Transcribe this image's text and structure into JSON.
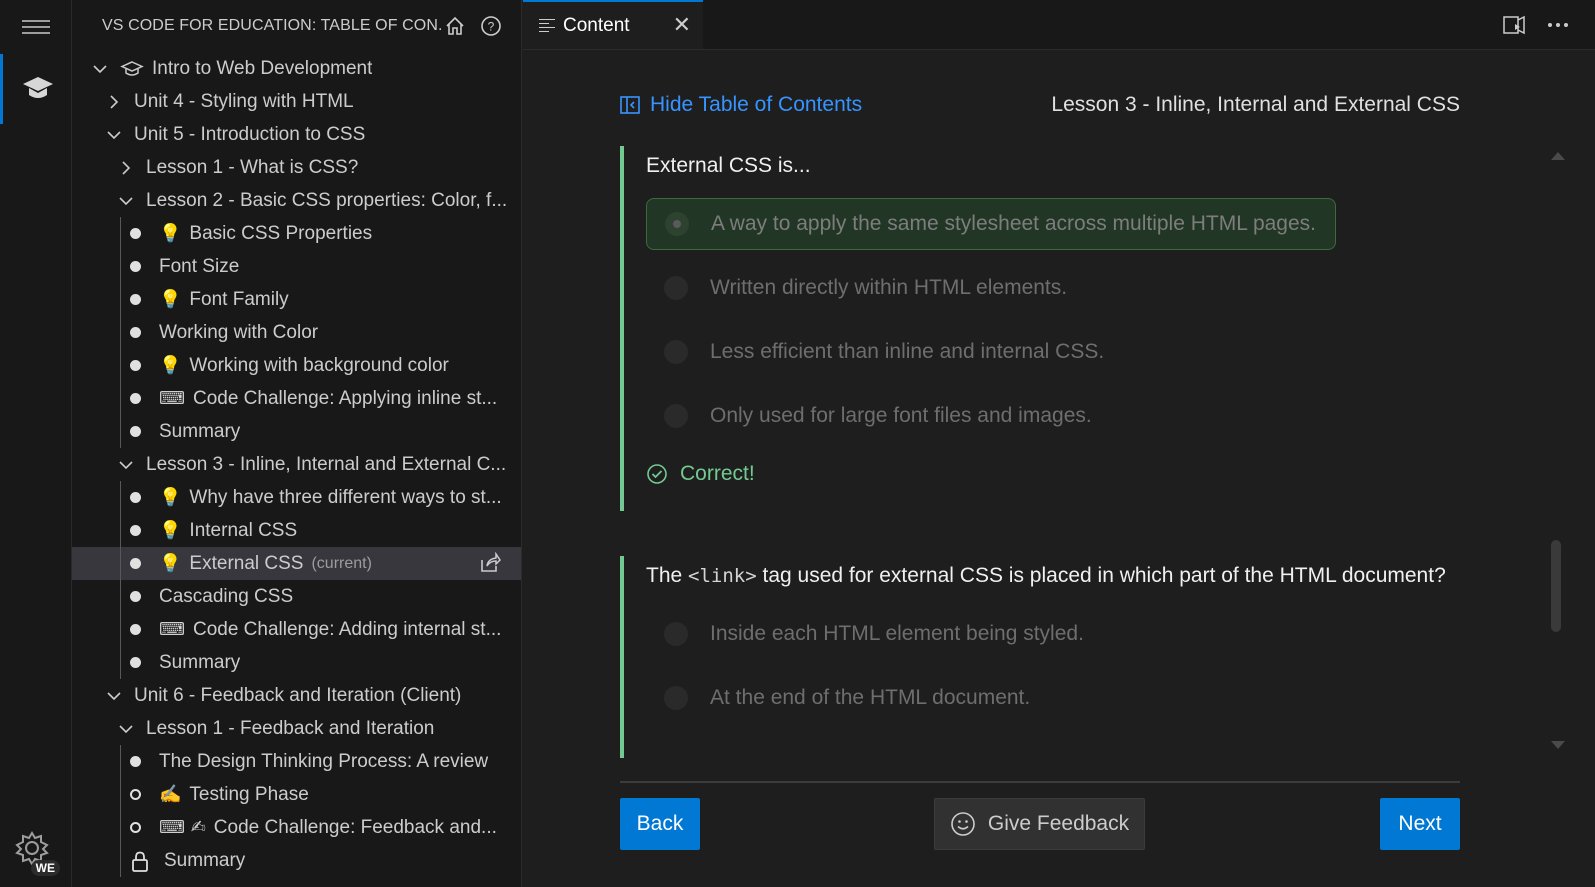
{
  "sidebar": {
    "title": "VS CODE FOR EDUCATION: TABLE OF CON...",
    "badge": "WE",
    "tree": [
      {
        "label": "Intro to Web Development",
        "level": 0,
        "chevron": "down",
        "icon": "course"
      },
      {
        "label": "Unit 4 - Styling with HTML",
        "level": 1,
        "chevron": "right"
      },
      {
        "label": "Unit 5 - Introduction to CSS",
        "level": 1,
        "chevron": "down"
      },
      {
        "label": "Lesson 1 - What is CSS?",
        "level": 2,
        "chevron": "right"
      },
      {
        "label": "Lesson 2 - Basic CSS properties: Color, f...",
        "level": 2,
        "chevron": "down"
      },
      {
        "label": "Basic CSS Properties",
        "level": 3,
        "bullet": "filled",
        "icon": "💡"
      },
      {
        "label": "Font Size",
        "level": 3,
        "bullet": "filled"
      },
      {
        "label": "Font Family",
        "level": 3,
        "bullet": "filled",
        "icon": "💡"
      },
      {
        "label": "Working with Color",
        "level": 3,
        "bullet": "filled"
      },
      {
        "label": "Working with background color",
        "level": 3,
        "bullet": "filled",
        "icon": "💡"
      },
      {
        "label": "Code Challenge: Applying inline st...",
        "level": 3,
        "bullet": "filled",
        "icon": "⌨"
      },
      {
        "label": "Summary",
        "level": 3,
        "bullet": "filled"
      },
      {
        "label": "Lesson 3 - Inline, Internal and External C...",
        "level": 2,
        "chevron": "down"
      },
      {
        "label": "Why have three different ways to st...",
        "level": 3,
        "bullet": "filled",
        "icon": "💡"
      },
      {
        "label": "Internal CSS",
        "level": 3,
        "bullet": "filled",
        "icon": "💡"
      },
      {
        "label": "External CSS",
        "level": 3,
        "bullet": "filled",
        "icon": "💡",
        "suffix": "(current)",
        "selected": true
      },
      {
        "label": "Cascading CSS",
        "level": 3,
        "bullet": "filled"
      },
      {
        "label": "Code Challenge: Adding internal st...",
        "level": 3,
        "bullet": "filled",
        "icon": "⌨"
      },
      {
        "label": "Summary",
        "level": 3,
        "bullet": "filled"
      },
      {
        "label": "Unit 6 - Feedback and Iteration (Client)",
        "level": 1,
        "chevron": "down"
      },
      {
        "label": "Lesson 1 - Feedback and Iteration",
        "level": 2,
        "chevron": "down"
      },
      {
        "label": "The Design Thinking Process: A review",
        "level": 3,
        "bullet": "filled"
      },
      {
        "label": "Testing Phase",
        "level": 3,
        "bullet": "empty",
        "icon": "✍"
      },
      {
        "label": "Code Challenge: Feedback and...",
        "level": 3,
        "bullet": "empty",
        "icon": "⌨ ✍"
      },
      {
        "label": "Summary",
        "level": 3,
        "bullet": "lock"
      }
    ]
  },
  "tab": {
    "label": "Content",
    "close": "✕"
  },
  "content": {
    "hide_toc": "Hide Table of Contents",
    "lesson_title": "Lesson 3 - Inline, Internal and External CSS",
    "q1": {
      "text": "External CSS is...",
      "options": [
        "A way to apply the same stylesheet across multiple HTML pages.",
        "Written directly within HTML elements.",
        "Less efficient than inline and internal CSS.",
        "Only used for large font files and images."
      ],
      "selected_index": 0,
      "result": "Correct!"
    },
    "q2": {
      "text_before": "The ",
      "code": "<link>",
      "text_after": " tag used for external CSS is placed in which part of the HTML document?",
      "options": [
        "Inside each HTML element being styled.",
        "At the end of the HTML document."
      ]
    }
  },
  "footer": {
    "back": "Back",
    "feedback": "Give Feedback",
    "next": "Next"
  },
  "colors": {
    "accent": "#0078d4",
    "link": "#3794ff",
    "success": "#73c991"
  }
}
